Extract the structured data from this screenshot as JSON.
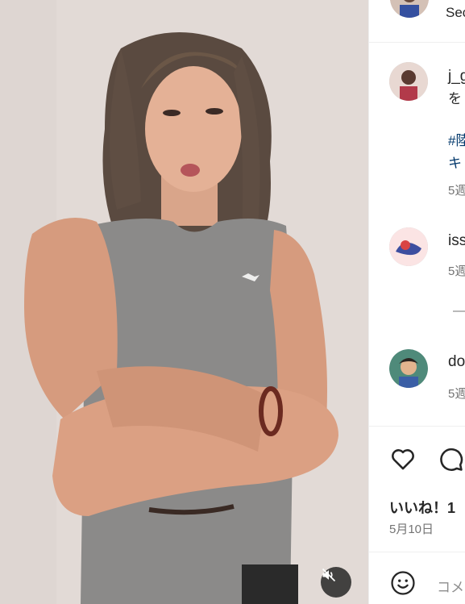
{
  "header": {
    "username_partial": "Sec"
  },
  "caption": {
    "username": "j_g",
    "text": "を",
    "hashtag_line1": "#陸",
    "hashtag_line2": "キ",
    "time": "5週"
  },
  "comments": [
    {
      "username": "iss",
      "time": "5週"
    },
    {
      "username": "do",
      "time": "5週"
    }
  ],
  "replies_line": "—",
  "actions": {
    "likes": "いいね！1",
    "date": "5月10日"
  },
  "comment_box": {
    "placeholder": "コメ"
  },
  "icons": [
    "mute-icon",
    "heart-icon",
    "comment-icon",
    "emoji-icon"
  ],
  "colors": {
    "link": "#00376b",
    "text": "#262626",
    "muted": "#737373",
    "divider": "#efefef"
  }
}
